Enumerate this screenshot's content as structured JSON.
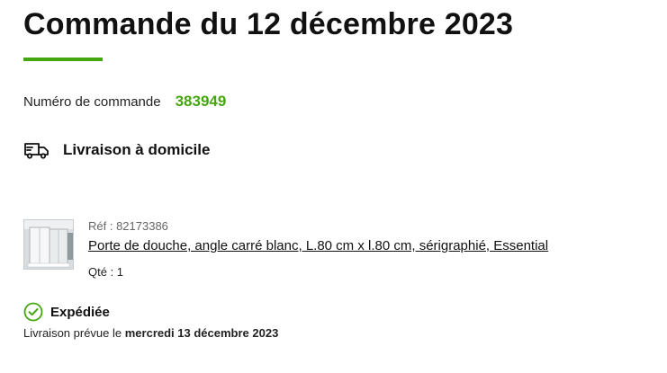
{
  "header": {
    "title": "Commande du 12 décembre 2023"
  },
  "order": {
    "number_label": "Numéro de commande",
    "number_value": "383949"
  },
  "delivery": {
    "icon": "truck-icon",
    "label": "Livraison à domicile"
  },
  "product": {
    "thumbnail": "shower-door-thumbnail",
    "ref": "Réf : 82173386",
    "name": "Porte de douche, angle carré blanc, L.80 cm x l.80 cm, sérigraphié, Essential",
    "quantity": "Qté : 1"
  },
  "status": {
    "icon": "check-circle-icon",
    "label": "Expédiée",
    "eta_prefix": "Livraison prévue le",
    "eta_date": "mercredi 13 décembre 2023"
  },
  "colors": {
    "accent": "#46a610"
  }
}
